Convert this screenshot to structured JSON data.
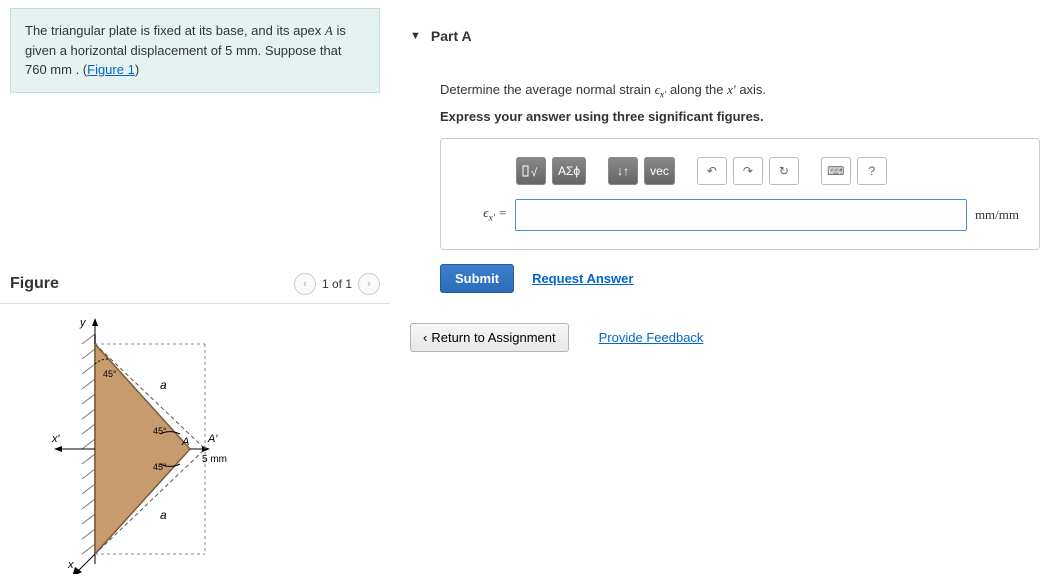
{
  "problem": {
    "text_before": "The triangular plate is fixed at its base, and its apex ",
    "apex_var": "A",
    "text_mid": " is given a horizontal displacement of 5 mm. Suppose that 760 mm . (",
    "figure_link": "Figure 1",
    "text_after": ")"
  },
  "figure": {
    "title": "Figure",
    "nav_text": "1 of 1",
    "labels": {
      "y": "y",
      "xprime": "x′",
      "x": "x",
      "a1": "a",
      "a2": "a",
      "ang_top": "45°",
      "ang_midA": "45°",
      "ang_midB": "45°",
      "A": "A",
      "Aprime": "A′",
      "disp": "5 mm"
    }
  },
  "part": {
    "title": "Part A",
    "question_before": "Determine the average normal strain ",
    "strain_symbol": "ϵx′",
    "question_mid": " along the ",
    "axis_symbol": "x′",
    "question_after": " axis.",
    "instruction": "Express your answer using three significant figures.",
    "toolbar": {
      "templates": "√",
      "greek": "ΑΣϕ",
      "subscript": "↓↑",
      "vec": "vec",
      "undo": "↶",
      "redo": "↷",
      "reset": "↻",
      "keyboard": "⌨",
      "help": "?"
    },
    "eq_label": "ϵx′ =",
    "unit": "mm/mm",
    "submit": "Submit",
    "request": "Request Answer"
  },
  "footer": {
    "return": "Return to Assignment",
    "feedback": "Provide Feedback"
  }
}
